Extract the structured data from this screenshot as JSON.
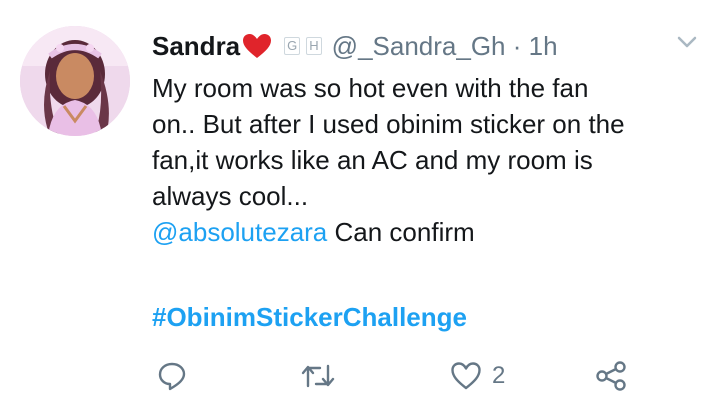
{
  "tweet": {
    "author_name": "Sandra",
    "flag_labels": [
      "G",
      "H"
    ],
    "handle": "@_Sandra_Gh",
    "separator": " · ",
    "time": "1h",
    "text": "My room was so hot even with the fan\non.. But after I used obinim sticker on the\nfan,it works like an AC and my room is\nalways cool...",
    "mention": "@absolutezara",
    "mention_text": " Can confirm",
    "hashtag": "#ObinimStickerChallenge"
  },
  "actions": {
    "like_count": "2"
  },
  "icons": {
    "heart_emoji": "red-heart-icon",
    "menu": "chevron-down-icon",
    "reply": "reply-icon",
    "retweet": "retweet-icon",
    "like": "heart-icon",
    "share": "share-icon"
  },
  "colors": {
    "link": "#1da1f2",
    "text": "#14171a",
    "muted": "#657786",
    "heart_emoji": "#e0242b"
  }
}
